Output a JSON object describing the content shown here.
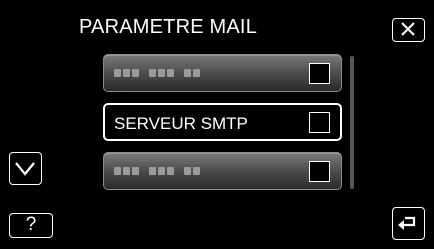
{
  "header": {
    "title": "PARAMETRE MAIL"
  },
  "controls": {
    "close_icon": "close-icon",
    "scroll_down_icon": "chevron-down-icon",
    "help_label": "?",
    "back_icon": "return-arrow-icon"
  },
  "menu": {
    "items": [
      {
        "label": "",
        "masked": true,
        "checked": false
      },
      {
        "label": "SERVEUR SMTP",
        "masked": false,
        "checked": false,
        "selected": true
      },
      {
        "label": "",
        "masked": true,
        "checked": false
      }
    ]
  },
  "colors": {
    "background": "#000000",
    "foreground": "#ffffff",
    "item_gray": "#5a5a5a"
  }
}
